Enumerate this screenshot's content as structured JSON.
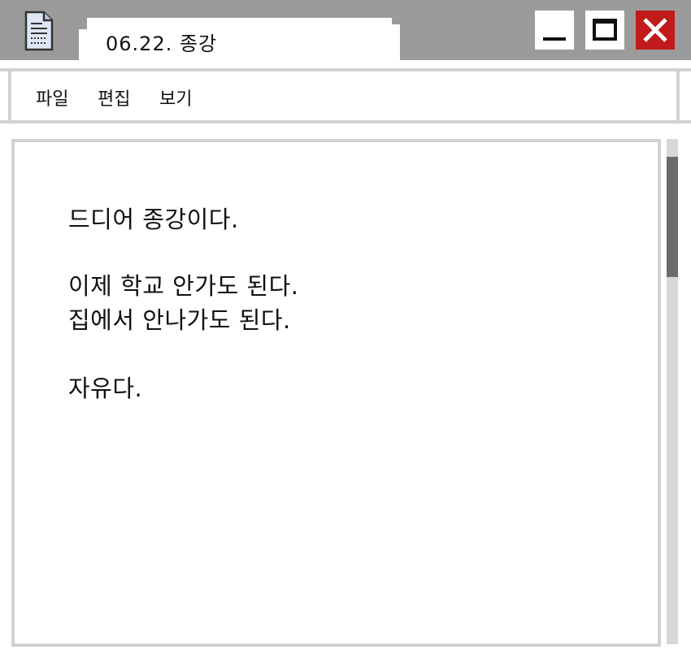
{
  "window": {
    "title": "06.22. 종강",
    "icon": "notepad-document-icon"
  },
  "controls": {
    "minimize_icon": "minimize-icon",
    "maximize_icon": "maximize-icon",
    "close_icon": "close-icon",
    "close_color": "#c01a1a"
  },
  "menu": {
    "items": [
      {
        "label": "파일"
      },
      {
        "label": "편집"
      },
      {
        "label": "보기"
      }
    ]
  },
  "editor": {
    "lines": [
      "드디어 종강이다.",
      "이제 학교 안가도 된다.",
      "집에서 안나가도 된다.",
      "자유다."
    ]
  },
  "scrollbar": {
    "position_fraction": 0.04,
    "visible_fraction": 0.24
  }
}
